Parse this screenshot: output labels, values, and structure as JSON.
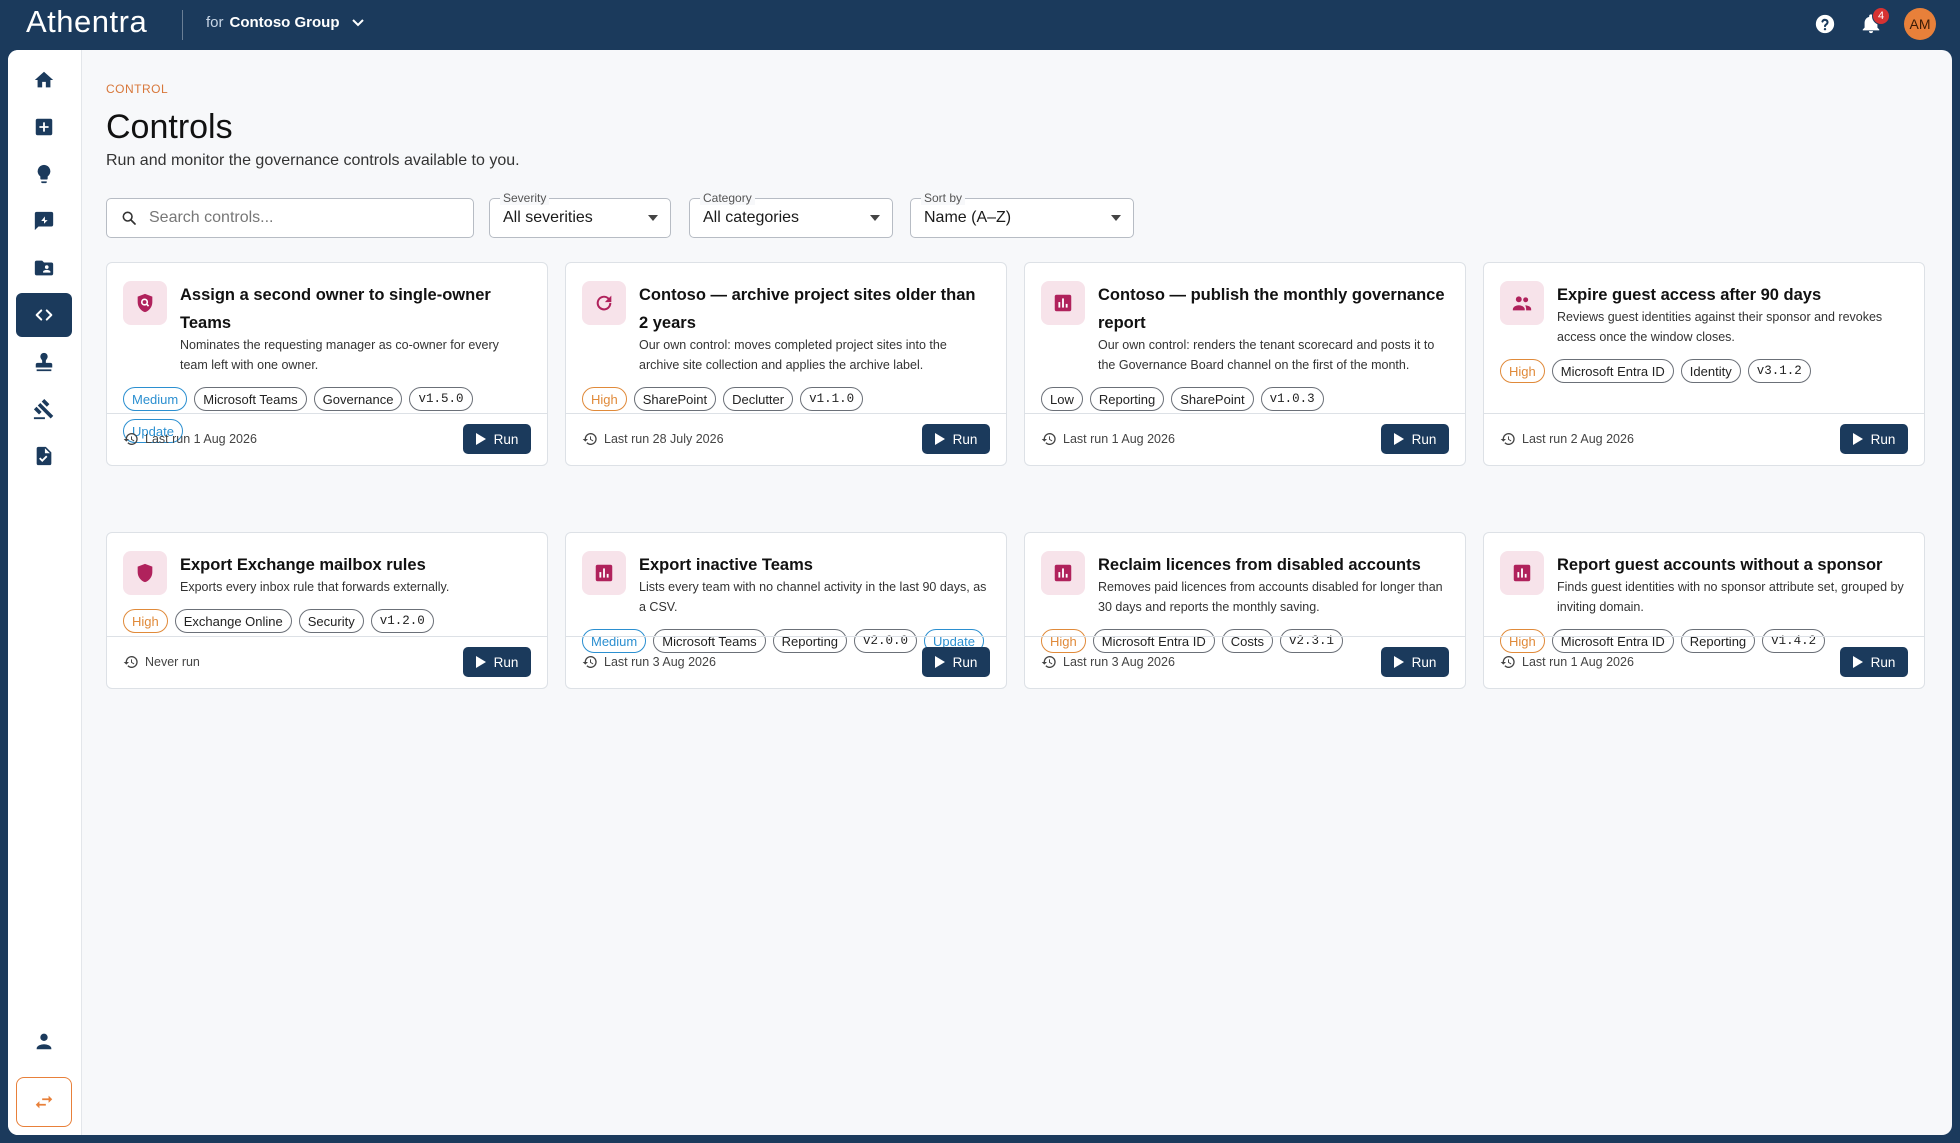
{
  "app": {
    "brand": "Athentra",
    "tenant_prefix": "for",
    "tenant_name": "Contoso Group",
    "notifications_count": "4",
    "avatar_initials": "AM"
  },
  "sidebar": {
    "items": [
      {
        "name": "home-icon"
      },
      {
        "name": "add-box-icon"
      },
      {
        "name": "lightbulb-icon"
      },
      {
        "name": "feedback-icon"
      },
      {
        "name": "folder-user-icon"
      },
      {
        "name": "code-icon",
        "active": true
      },
      {
        "name": "stamp-icon"
      },
      {
        "name": "gavel-icon"
      },
      {
        "name": "task-doc-icon"
      }
    ],
    "bottom": [
      {
        "name": "person-icon"
      },
      {
        "name": "swap-icon"
      }
    ]
  },
  "page": {
    "eyebrow": "CONTROL",
    "title": "Controls",
    "subtitle": "Run and monitor the governance controls available to you."
  },
  "filters": {
    "search_placeholder": "Search controls...",
    "severity_label": "Severity",
    "severity_value": "All severities",
    "category_label": "Category",
    "category_value": "All categories",
    "sort_label": "Sort by",
    "sort_value": "Name (A–Z)"
  },
  "run_label": "Run",
  "colors": {
    "brand_navy": "#1b3a5c",
    "accent_orange": "#e8803a",
    "medium_blue": "#2b8fd0",
    "high_orange": "#e08a3a",
    "icon_magenta": "#b0225c"
  },
  "cards": [
    {
      "icon": "shield-search-icon",
      "title": "Assign a second owner to single-owner Teams",
      "description": "Nominates the requesting manager as co-owner for every team left with one owner.",
      "severity": "Medium",
      "tags": [
        "Microsoft Teams",
        "Governance"
      ],
      "version": "v1.5.0",
      "update": "Update",
      "last_run": "Last run 1 Aug 2026"
    },
    {
      "icon": "refresh-icon",
      "title": "Contoso — archive project sites older than 2 years",
      "description": "Our own control: moves completed project sites into the archive site collection and applies the archive label.",
      "severity": "High",
      "tags": [
        "SharePoint",
        "Declutter"
      ],
      "version": "v1.1.0",
      "last_run": "Last run 28 July 2026"
    },
    {
      "icon": "chart-icon",
      "title": "Contoso — publish the monthly governance report",
      "description": "Our own control: renders the tenant scorecard and posts it to the Governance Board channel on the first of the month.",
      "severity": "Low",
      "tags": [
        "Reporting",
        "SharePoint"
      ],
      "version": "v1.0.3",
      "last_run": "Last run 1 Aug 2026"
    },
    {
      "icon": "people-icon",
      "title": "Expire guest access after 90 days",
      "description": "Reviews guest identities against their sponsor and revokes access once the window closes.",
      "severity": "High",
      "tags": [
        "Microsoft Entra ID",
        "Identity"
      ],
      "version": "v3.1.2",
      "last_run": "Last run 2 Aug 2026"
    },
    {
      "icon": "shield-icon",
      "title": "Export Exchange mailbox rules",
      "description": "Exports every inbox rule that forwards externally.",
      "severity": "High",
      "tags": [
        "Exchange Online",
        "Security"
      ],
      "version": "v1.2.0",
      "last_run": "Never run"
    },
    {
      "icon": "chart-icon",
      "title": "Export inactive Teams",
      "description": "Lists every team with no channel activity in the last 90 days, as a CSV.",
      "severity": "Medium",
      "tags": [
        "Microsoft Teams",
        "Reporting"
      ],
      "version": "v2.0.0",
      "update": "Update",
      "last_run": "Last run 3 Aug 2026"
    },
    {
      "icon": "chart-icon",
      "title": "Reclaim licences from disabled accounts",
      "description": "Removes paid licences from accounts disabled for longer than 30 days and reports the monthly saving.",
      "severity": "High",
      "tags": [
        "Microsoft Entra ID",
        "Costs"
      ],
      "version": "v2.3.1",
      "last_run": "Last run 3 Aug 2026"
    },
    {
      "icon": "chart-icon",
      "title": "Report guest accounts without a sponsor",
      "description": "Finds guest identities with no sponsor attribute set, grouped by inviting domain.",
      "severity": "High",
      "tags": [
        "Microsoft Entra ID",
        "Reporting"
      ],
      "version": "v1.4.2",
      "last_run": "Last run 1 Aug 2026"
    }
  ]
}
